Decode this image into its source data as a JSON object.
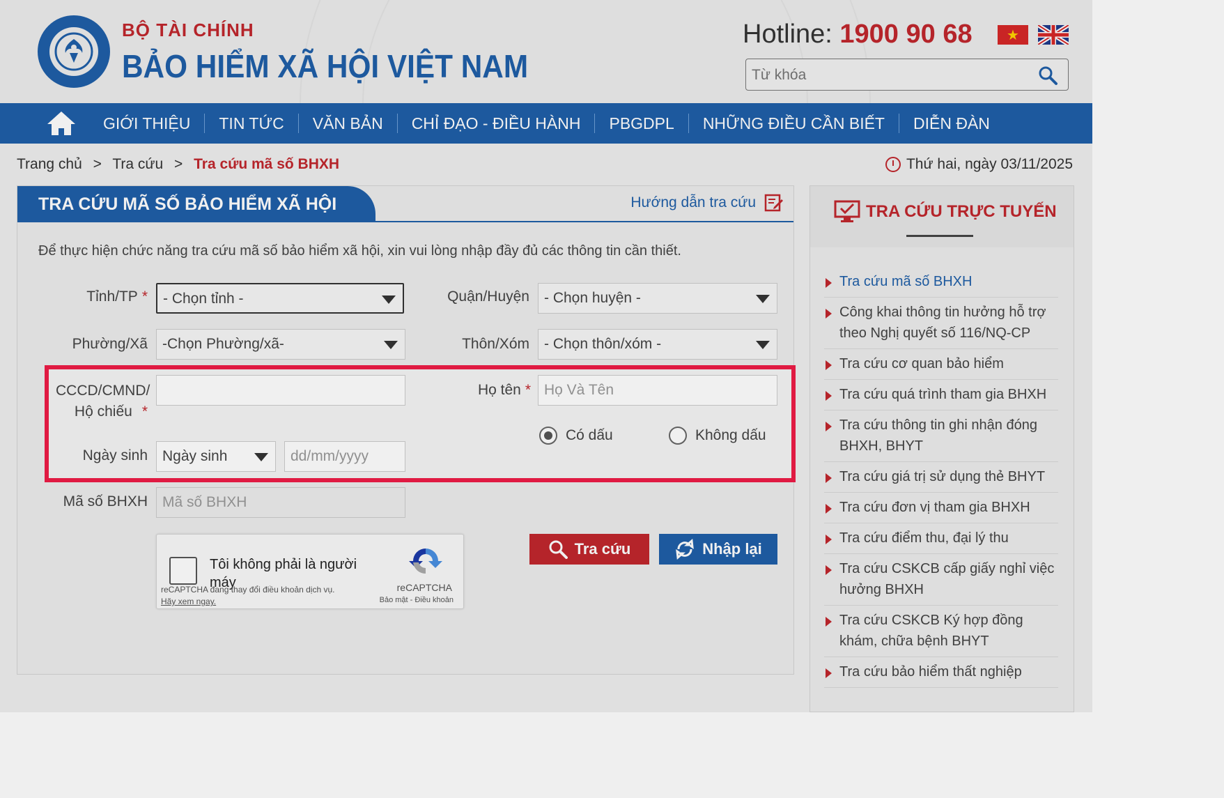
{
  "header": {
    "ministry": "BỘ TÀI CHÍNH",
    "agency": "BẢO HIỂM XÃ HỘI VIỆT NAM",
    "hotline_label": "Hotline: ",
    "hotline_number": "1900 90 68",
    "search_placeholder": "Từ khóa"
  },
  "nav": {
    "items": [
      "GIỚI THIỆU",
      "TIN TỨC",
      "VĂN BẢN",
      "CHỈ ĐẠO - ĐIỀU HÀNH",
      "PBGDPL",
      "NHỮNG ĐIỀU CẦN BIẾT",
      "DIỄN ĐÀN"
    ]
  },
  "breadcrumb": {
    "home": "Trang chủ",
    "sep": ">",
    "section": "Tra cứu",
    "current": "Tra cứu mã số BHXH"
  },
  "date": "Thứ hai, ngày 03/11/2025",
  "panel": {
    "title": "TRA CỨU MÃ SỐ BẢO HIỂM XÃ HỘI",
    "guide": "Hướng dẫn tra cứu",
    "intro": "Để thực hiện chức năng tra cứu mã số bảo hiểm xã hội, xin vui lòng nhập đầy đủ các thông tin cần thiết."
  },
  "form": {
    "province_label": "Tỉnh/TP",
    "province_value": "- Chọn tỉnh -",
    "district_label": "Quận/Huyện",
    "district_value": "- Chọn huyện -",
    "ward_label": "Phường/Xã",
    "ward_value": "-Chọn Phường/xã-",
    "village_label": "Thôn/Xóm",
    "village_value": "- Chọn thôn/xóm -",
    "id_label_1": "CCCD/CMND/",
    "id_label_2": "Hộ chiếu",
    "id_value": "",
    "name_label": "Họ tên",
    "name_placeholder": "Họ Và Tên",
    "radio_accent": "Có dấu",
    "radio_no_accent": "Không dấu",
    "dob_label": "Ngày sinh",
    "dob_select": "Ngày sinh",
    "dob_placeholder": "dd/mm/yyyy",
    "ssn_label": "Mã số BHXH",
    "ssn_placeholder": "Mã số BHXH",
    "required_mark": "*"
  },
  "captcha": {
    "text": "Tôi không phải là người máy",
    "brand": "reCAPTCHA",
    "links": "Bảo mật - Điều khoản",
    "notice": "reCAPTCHA đang thay đổi điều khoản dịch vụ.",
    "notice_link": "Hãy xem ngay."
  },
  "buttons": {
    "search": "Tra cứu",
    "reset": "Nhập lại"
  },
  "sidebar": {
    "title": "TRA CỨU TRỰC TUYẾN",
    "items": [
      "Tra cứu mã số BHXH",
      "Công khai thông tin hưởng hỗ trợ theo Nghị quyết số 116/NQ-CP",
      "Tra cứu cơ quan bảo hiểm",
      "Tra cứu quá trình tham gia BHXH",
      "Tra cứu thông tin ghi nhận đóng BHXH, BHYT",
      "Tra cứu giá trị sử dụng thẻ BHYT",
      "Tra cứu đơn vị tham gia BHXH",
      "Tra cứu điểm thu, đại lý thu",
      "Tra cứu CSKCB cấp giấy nghỉ việc hưởng BHXH",
      "Tra cứu CSKCB Ký hợp đồng khám, chữa bệnh BHYT",
      "Tra cứu bảo hiểm thất nghiệp"
    ]
  },
  "colors": {
    "brand_blue": "#1f5fa8",
    "brand_red": "#c1272d",
    "highlight": "#ee1c47"
  }
}
